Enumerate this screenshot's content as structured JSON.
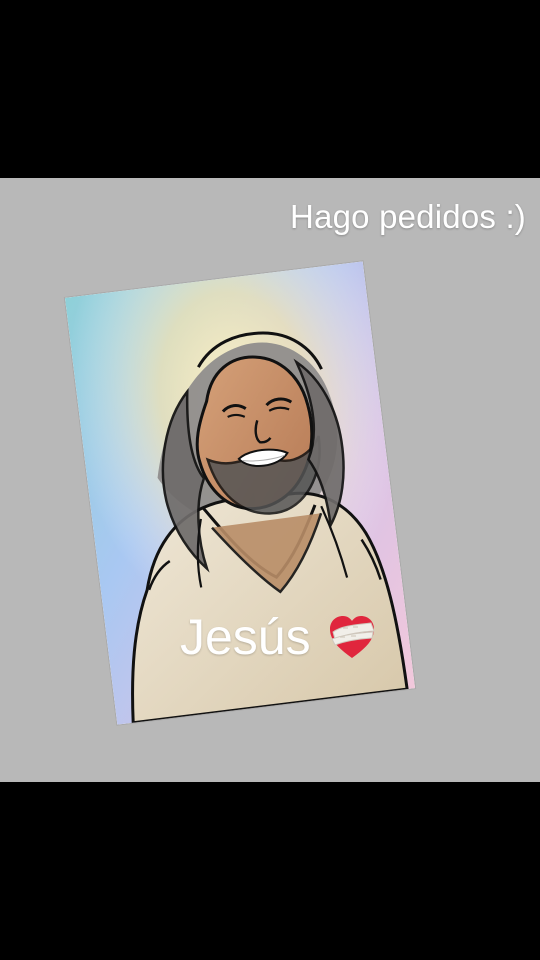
{
  "caption": "Hago pedidos :)",
  "artwork": {
    "subject": "Jesus smiling illustration",
    "label": "Jesús",
    "emoji_icon": "mending-heart-icon"
  },
  "colors": {
    "letterbox": "#000000",
    "background": "#b8b8b8",
    "text": "#ffffff",
    "heart": "#e0263d",
    "bandage": "#f1efe9"
  }
}
